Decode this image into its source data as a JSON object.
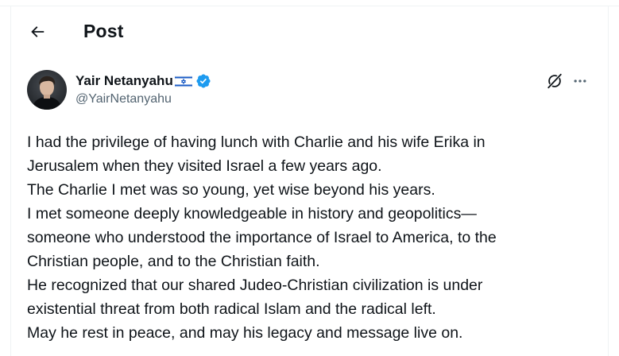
{
  "header": {
    "title": "Post",
    "back_icon": "arrow-left-icon"
  },
  "author": {
    "display_name": "Yair Netanyahu",
    "flag_icon": "israel-flag-icon",
    "verified_icon": "verified-badge-icon",
    "handle": "@YairNetanyahu",
    "verified_color": "#1d9bf0"
  },
  "actions": {
    "grok_icon": "grok-icon",
    "more_icon": "more-horizontal-icon"
  },
  "post": {
    "lines": [
      "I had the privilege of having lunch with Charlie and his wife Erika in",
      "Jerusalem when they visited Israel a few years ago.",
      "The Charlie I met was so young, yet wise beyond his years.",
      "I met someone deeply knowledgeable in history and geopolitics—",
      "someone who understood the importance of Israel to America, to the",
      "Christian people, and to the Christian faith.",
      "He recognized that our shared Judeo-Christian civilization is under",
      "existential threat from both radical Islam and the radical left.",
      "May he rest in peace, and may his legacy and message live on."
    ]
  },
  "colors": {
    "text_primary": "#0f1419",
    "text_secondary": "#536471",
    "border": "#eff3f4",
    "accent": "#1d9bf0"
  }
}
